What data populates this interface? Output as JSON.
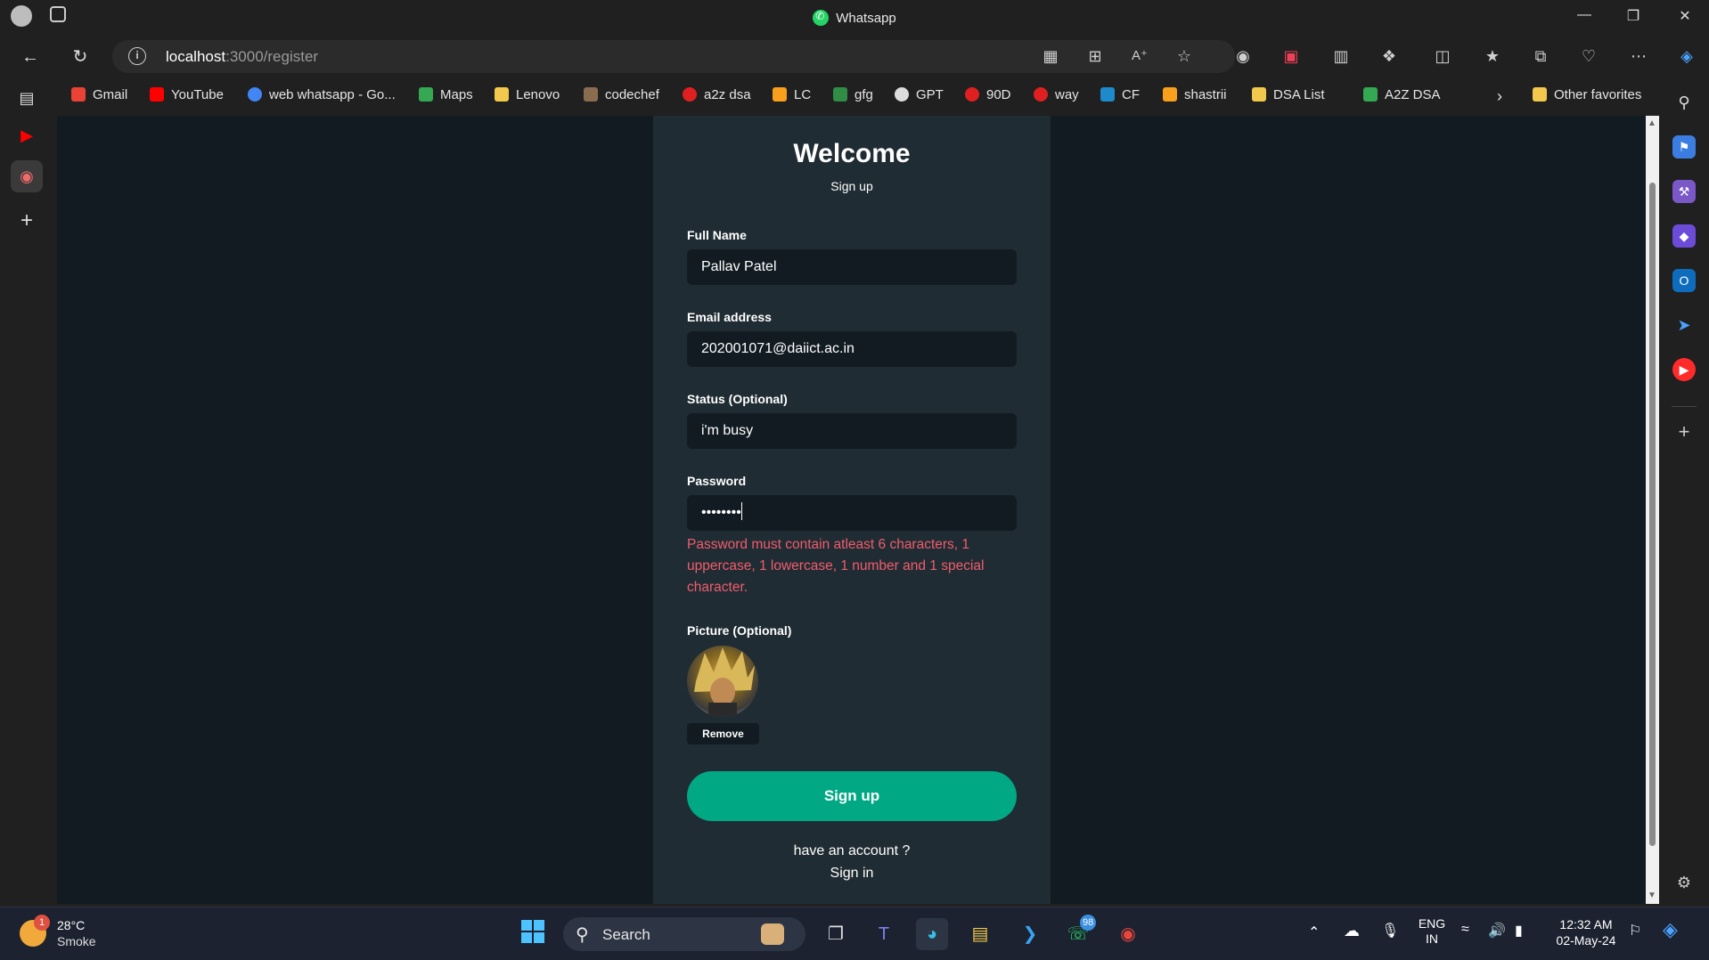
{
  "window": {
    "title": "Whatsapp"
  },
  "address_bar": {
    "host": "localhost",
    "path": ":3000/register"
  },
  "bookmarks": [
    {
      "label": "Gmail",
      "color": "#ea4335"
    },
    {
      "label": "YouTube",
      "color": "#ff0000"
    },
    {
      "label": "web whatsapp - Go...",
      "color": "#4285f4"
    },
    {
      "label": "Maps",
      "color": "#34a853"
    },
    {
      "label": "Lenovo",
      "color": "#f2c94c"
    },
    {
      "label": "codechef",
      "color": "#8a6d4e"
    },
    {
      "label": "a2z dsa",
      "color": "#e02020"
    },
    {
      "label": "LC",
      "color": "#f89f1b"
    },
    {
      "label": "gfg",
      "color": "#2f8d46"
    },
    {
      "label": "GPT",
      "color": "#dddddd"
    },
    {
      "label": "90D",
      "color": "#e02020"
    },
    {
      "label": "way",
      "color": "#e02020"
    },
    {
      "label": "CF",
      "color": "#1f8acb"
    },
    {
      "label": "shastrii",
      "color": "#f89f1b"
    },
    {
      "label": "DSA List",
      "color": "#f2c94c"
    },
    {
      "label": "A2Z DSA",
      "color": "#34a853"
    }
  ],
  "other_favorites": "Other favorites",
  "form": {
    "heading": "Welcome",
    "subheading": "Sign up",
    "full_name_label": "Full Name",
    "full_name_value": "Pallav Patel",
    "email_label": "Email address",
    "email_value": "202001071@daiict.ac.in",
    "status_label": "Status (Optional)",
    "status_value": "i'm busy",
    "password_label": "Password",
    "password_value": "••••••••",
    "password_error": "Password must contain atleast 6 characters, 1 uppercase, 1 lowercase, 1 number and 1 special character.",
    "picture_label": "Picture (Optional)",
    "remove_label": "Remove",
    "submit_label": "Sign up",
    "have_account_text": "have an account ?",
    "signin_link": "Sign in"
  },
  "taskbar": {
    "weather_temp": "28°C",
    "weather_desc": "Smoke",
    "weather_badge": "1",
    "search_label": "Search",
    "whatsapp_badge": "98",
    "lang_top": "ENG",
    "lang_bottom": "IN",
    "time": "12:32 AM",
    "date": "02-May-24"
  },
  "colors": {
    "accent_green": "#00a884",
    "error_red": "#f15c6d",
    "page_bg": "#111b21",
    "card_bg": "#202c33"
  }
}
